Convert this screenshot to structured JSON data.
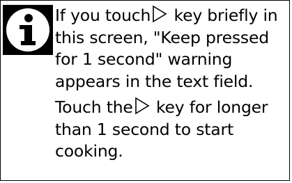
{
  "info_panel": {
    "icon": "info-icon",
    "paragraph1": {
      "line1_a": "If you touch",
      "line1_icon": "play-key-icon",
      "line1_b": " key briefly in",
      "line2": "this screen, \"Keep pressed",
      "line3": "for 1 second\" warning",
      "line4": "appears in the text field."
    },
    "paragraph2": {
      "line1_a": "Touch the",
      "line1_icon": "play-key-icon",
      "line1_b": " key for longer",
      "line2": "than 1 second to start",
      "line3": "cooking."
    }
  }
}
